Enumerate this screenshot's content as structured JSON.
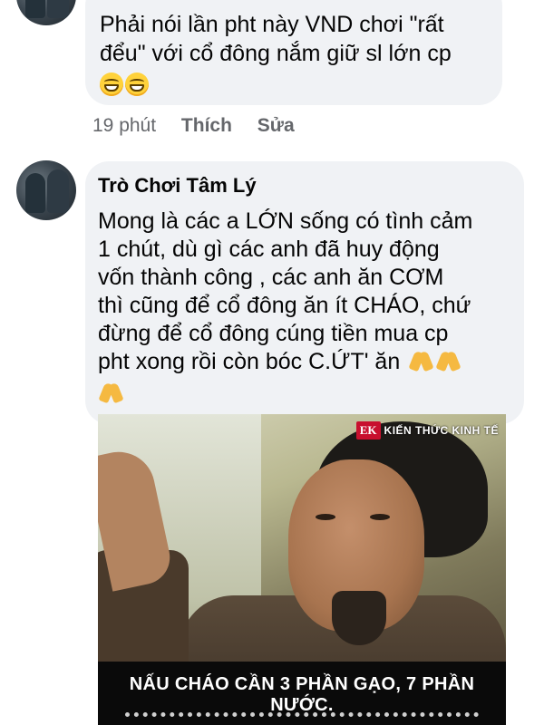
{
  "comment1": {
    "message_lines": [
      "Phải nói lần pht này VND chơi \"rất",
      "đểu\" với cổ đông nắm giữ sl lớn cp"
    ],
    "emoji": [
      "grinning-face-icon",
      "grinning-face-icon"
    ],
    "actions": {
      "time": "19 phút",
      "like": "Thích",
      "edit": "Sửa"
    }
  },
  "comment2": {
    "author": "Trò Chơi Tâm Lý",
    "message_lines": [
      "Mong là các a LỚN sống có tình cảm",
      "1 chút, dù gì các anh đã huy động",
      "vốn thành công , các anh ăn CƠM",
      "thì cũng để cổ đông ăn ít CHÁO, chứ",
      "đừng để cổ đông cúng tiền mua cp",
      "pht xong rồi còn bóc C.ỨT' ăn"
    ],
    "emoji": [
      "folded-hands-icon",
      "folded-hands-icon",
      "folded-hands-icon"
    ],
    "image": {
      "watermark_logo": "EK",
      "watermark_text": "KIẾN THỨC KINH TẾ",
      "caption": "NẤU CHÁO CẦN 3 PHẦN GẠO, 7 PHẦN NƯỚC."
    }
  },
  "colors": {
    "bubble_bg": "#f0f2f5",
    "action_text": "#65676b",
    "watermark_red": "#c8102e"
  }
}
